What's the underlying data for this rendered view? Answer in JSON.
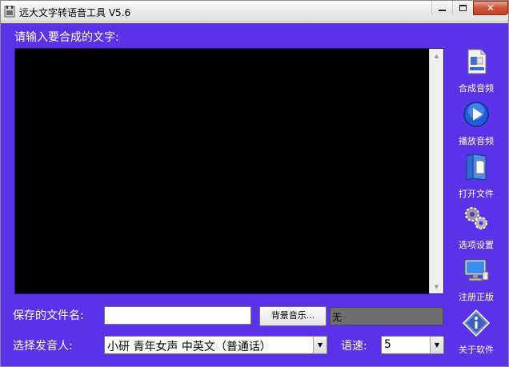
{
  "window": {
    "title": "远大文字转语音工具 V5.6",
    "controls": {
      "minimize": "",
      "maximize": "",
      "close": "✕"
    }
  },
  "editor": {
    "prompt": "请输入要合成的文字:",
    "value": ""
  },
  "toolbar": {
    "synthesize": {
      "label": "合成音频",
      "icon": "wav-file-icon"
    },
    "play": {
      "label": "播放音频",
      "icon": "play-icon"
    },
    "open": {
      "label": "打开文件",
      "icon": "open-file-icon"
    },
    "settings": {
      "label": "选项设置",
      "icon": "gears-icon"
    },
    "register": {
      "label": "注册正版",
      "icon": "monitor-icon"
    },
    "about": {
      "label": "关于软件",
      "icon": "info-icon"
    }
  },
  "save": {
    "label": "保存的文件名:",
    "filename": "",
    "bgm_button": "背景音乐...",
    "bgm_value": "无"
  },
  "voice": {
    "label": "选择发音人:",
    "selected": "小研  青年女声  中英文（普通话）",
    "speed_label": "语速:",
    "speed_value": "5"
  },
  "colors": {
    "client_bg": "#5a32e8",
    "editor_bg": "#000000",
    "text": "#ffffff"
  }
}
